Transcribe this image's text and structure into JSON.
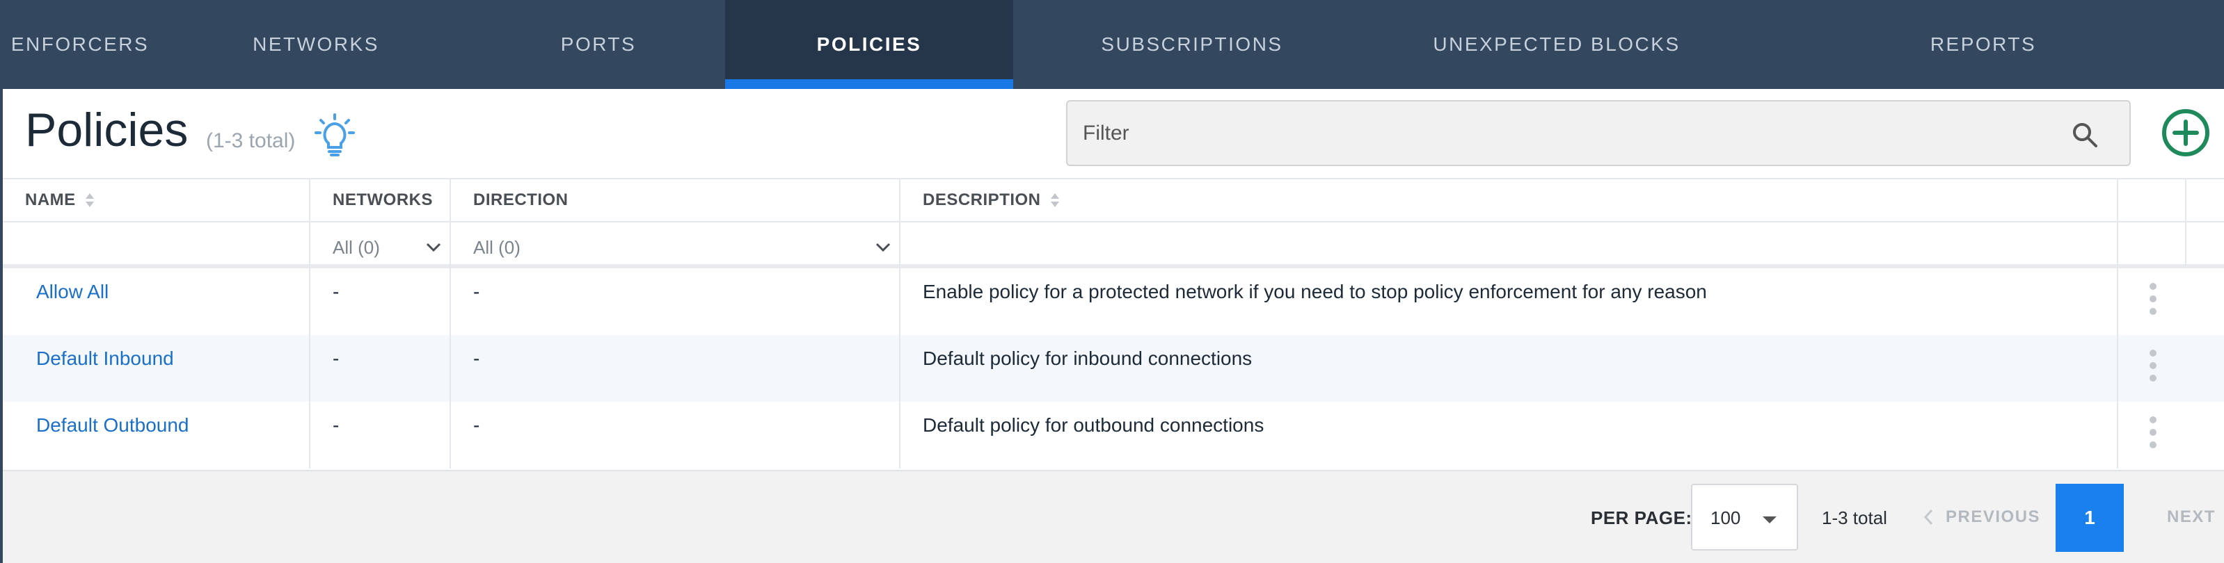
{
  "nav": {
    "tabs": [
      {
        "label": "ENFORCERS",
        "active": false
      },
      {
        "label": "NETWORKS",
        "active": false
      },
      {
        "label": "PORTS",
        "active": false
      },
      {
        "label": "POLICIES",
        "active": true
      },
      {
        "label": "SUBSCRIPTIONS",
        "active": false
      },
      {
        "label": "UNEXPECTED BLOCKS",
        "active": false
      },
      {
        "label": "REPORTS",
        "active": false
      }
    ]
  },
  "header": {
    "title": "Policies",
    "count": "(1-3 total)",
    "hint_icon": "lightbulb-icon",
    "filter_placeholder": "Filter",
    "filter_value": "",
    "search_icon": "search-icon",
    "add_icon": "plus-circle-icon"
  },
  "table": {
    "columns": {
      "name": "NAME",
      "networks": "NETWORKS",
      "direction": "DIRECTION",
      "description": "DESCRIPTION"
    },
    "filters": {
      "networks": "All (0)",
      "direction": "All (0)"
    },
    "rows": [
      {
        "name": "Allow All",
        "networks": "-",
        "direction": "-",
        "description": "Enable policy for a protected network if you need to stop policy enforcement for any reason"
      },
      {
        "name": "Default Inbound",
        "networks": "-",
        "direction": "-",
        "description": "Default policy for inbound connections"
      },
      {
        "name": "Default Outbound",
        "networks": "-",
        "direction": "-",
        "description": "Default policy for outbound connections"
      }
    ]
  },
  "pagination": {
    "per_page_label": "PER PAGE:",
    "per_page_value": "100",
    "total_text": "1-3 total",
    "previous_label": "PREVIOUS",
    "next_label": "NEXT",
    "current_page": "1"
  },
  "colors": {
    "nav_bg": "#33475f",
    "nav_active_bg": "#25364b",
    "accent": "#1a78e6",
    "link": "#1a6fc9",
    "add_button": "#1e8a5c",
    "hint_icon": "#4aa0e6"
  }
}
